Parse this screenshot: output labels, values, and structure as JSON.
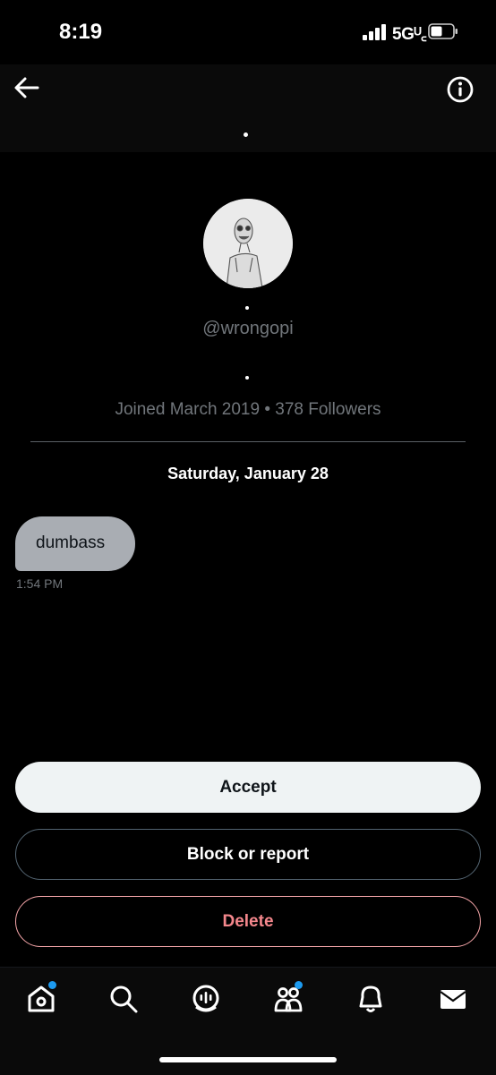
{
  "status_bar": {
    "time": "8:19",
    "network": "5Gᵁ꜀"
  },
  "profile": {
    "handle": "@wrongopi",
    "meta": "Joined March 2019 • 378 Followers"
  },
  "conversation": {
    "date": "Saturday, January 28",
    "messages": [
      {
        "text": "dumbass",
        "time": "1:54 PM"
      }
    ]
  },
  "actions": {
    "accept": "Accept",
    "block_or_report": "Block or report",
    "delete": "Delete"
  },
  "tabs": [
    {
      "icon": "home-icon",
      "badge": true
    },
    {
      "icon": "search-icon",
      "badge": false
    },
    {
      "icon": "spaces-icon",
      "badge": false
    },
    {
      "icon": "communities-icon",
      "badge": true
    },
    {
      "icon": "bell-icon",
      "badge": false
    },
    {
      "icon": "mail-icon",
      "badge": false
    }
  ],
  "colors": {
    "background": "#000000",
    "accent": "#1d9bf0",
    "delete": "#f4878c"
  }
}
